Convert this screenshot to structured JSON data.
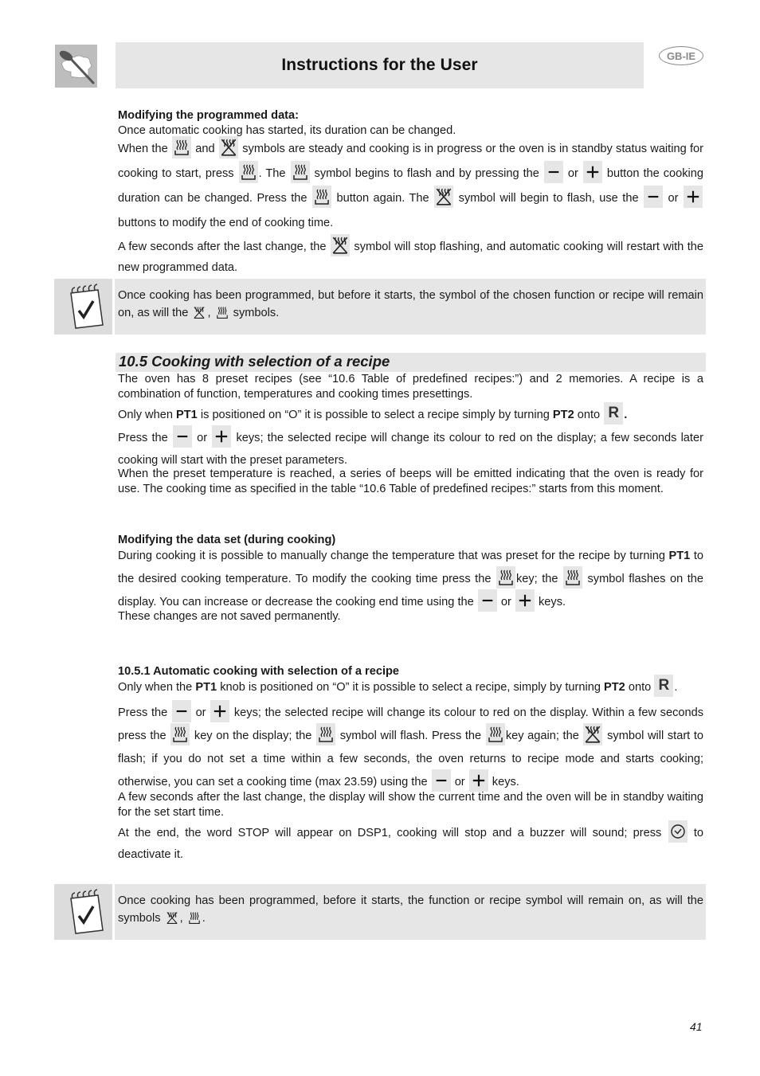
{
  "header": {
    "title": "Instructions for the User",
    "language_badge": "GB-IE",
    "logo": "chef-hat-spoon-icon"
  },
  "modifying_programmed": {
    "heading": "Modifying the programmed data:",
    "line1": "Once automatic cooking has started, its duration can be changed.",
    "p2": [
      "When the",
      "and",
      "symbols are steady and cooking is in progress or the oven is in standby status waiting for cooking to start, press",
      ". The",
      "symbol begins to flash and by pressing the",
      "or",
      "button the cooking duration can be changed. Press the",
      "button again. The",
      "symbol will begin to flash, use the",
      "or",
      "buttons to modify the end of cooking time."
    ],
    "p3": [
      "A few seconds after the last change, the",
      "symbol will stop flashing, and automatic cooking will restart with the new programmed data."
    ]
  },
  "note1": {
    "icon": "notepad-check-icon",
    "text": [
      "Once cooking has been programmed, but before it starts, the symbol of the chosen function or recipe will remain on, as will the",
      ",",
      "symbols."
    ]
  },
  "section_10_5": {
    "heading": "10.5 Cooking with selection of a recipe",
    "p1": "The oven has 8 preset recipes (see “10.6 Table of predefined recipes:”) and 2 memories. A recipe is a combination of function, temperatures and cooking times presettings.",
    "p2": [
      "Only when",
      "PT1",
      "is positioned on “O” it is possible to select a recipe simply by turning",
      "PT2",
      "onto",
      "."
    ],
    "recipe_key": "R",
    "p3": [
      "Press the",
      "or",
      "keys; the selected recipe will change its colour to red on the display; a few seconds later cooking will start with the preset parameters."
    ],
    "p4": "When the preset temperature is reached, a series of beeps will be emitted indicating that the oven is ready for use. The cooking time as specified in the table “10.6 Table of predefined recipes:” starts from this moment."
  },
  "modifying_data_set": {
    "heading": "Modifying the data set (during cooking)",
    "p1": [
      "During cooking it is possible to manually change the temperature that was preset for the recipe by turning",
      "PT1",
      "to the desired cooking temperature. To modify the cooking time press the",
      "key; the",
      "symbol flashes on the display. You can increase or decrease the cooking end time using the",
      "or",
      "keys."
    ],
    "p2": "These changes are not saved permanently."
  },
  "section_10_5_1": {
    "heading": "10.5.1 Automatic cooking with selection of a recipe",
    "p1": [
      "Only when the",
      "PT1",
      "knob is positioned on “O” it is possible to select a recipe, simply by turning",
      "PT2",
      "onto",
      "."
    ],
    "recipe_key": "R",
    "p2": [
      "Press the",
      "or",
      "keys; the selected recipe will change its colour to red on the display. Within a few seconds press the",
      "key on the display; the",
      "symbol will flash. Press the",
      "key again; the",
      "symbol will start to flash; if you do not set a time within a few seconds, the oven returns to recipe mode and starts cooking; otherwise, you can set a cooking time (max 23.59) using the",
      "or",
      "keys."
    ],
    "p3": "A few seconds after the last change, the display will show the current time and the oven will be in standby waiting for the set start time.",
    "p4": [
      "At the end, the word STOP will appear on DSP1, cooking will stop and a buzzer will sound; press",
      "to deactivate it."
    ]
  },
  "note2": {
    "icon": "notepad-check-icon",
    "text": [
      "Once cooking has been programmed, before it starts, the function or recipe symbol will remain on, as will the symbols",
      ",",
      "."
    ]
  },
  "footer": {
    "page_number": "41"
  }
}
